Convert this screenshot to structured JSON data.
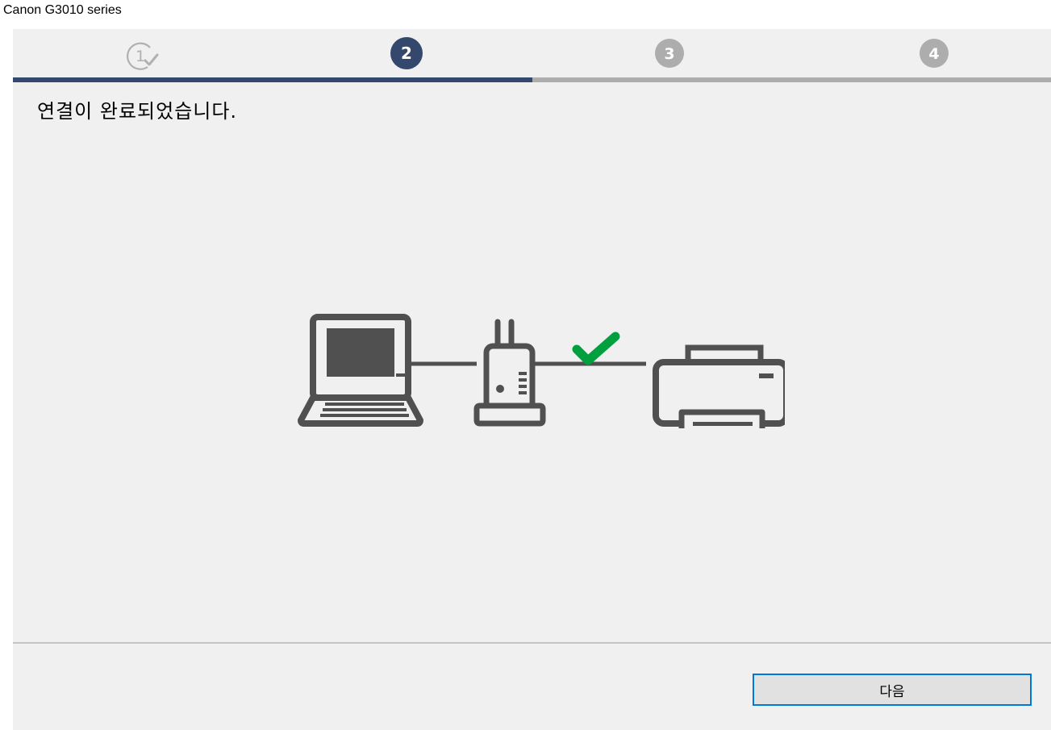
{
  "window": {
    "title": "Canon G3010 series"
  },
  "steps": [
    {
      "number": "1",
      "state": "completed",
      "icon": "check-circle-icon"
    },
    {
      "number": "2",
      "state": "current"
    },
    {
      "number": "3",
      "state": "pending"
    },
    {
      "number": "4",
      "state": "pending"
    }
  ],
  "progress": {
    "current_step": 2,
    "total_steps": 4
  },
  "main": {
    "heading": "연결이 완료되었습니다.",
    "illustration": [
      "laptop-icon",
      "router-icon",
      "checkmark-icon",
      "printer-icon"
    ]
  },
  "footer": {
    "next_label": "다음"
  },
  "colors": {
    "current_step": "#34486e",
    "pending_step": "#adadad",
    "completed_step": "#b0b0b0",
    "progress_fill": "#34486e",
    "progress_track": "#adadad",
    "check": "#00a03e",
    "device_stroke": "#505050",
    "button_border": "#0078d7",
    "button_face": "#e1e1e1",
    "background": "#f0f0f0"
  }
}
